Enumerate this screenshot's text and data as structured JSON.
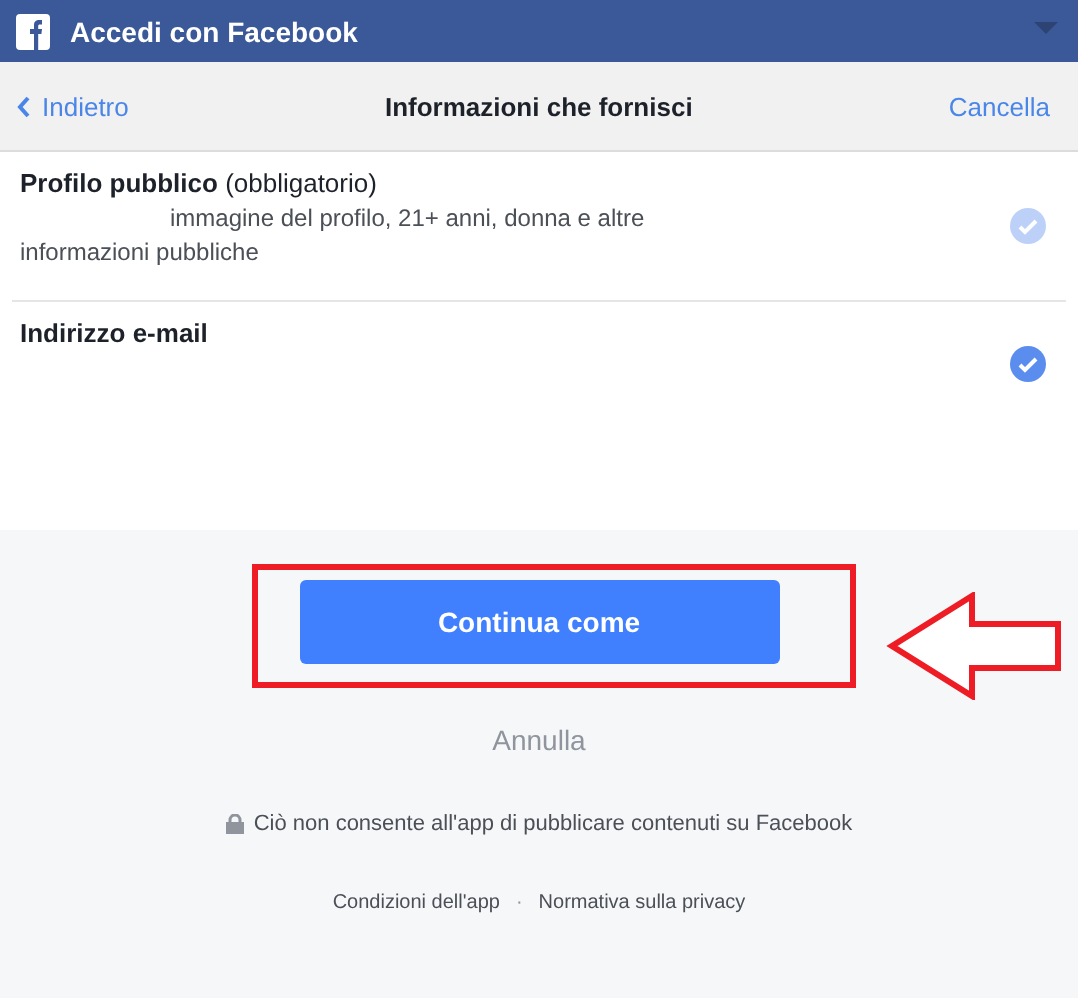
{
  "window": {
    "title": "Accedi con Facebook"
  },
  "nav": {
    "back": "Indietro",
    "title": "Informazioni che fornisci",
    "cancel": "Cancella"
  },
  "permissions": [
    {
      "title": "Profilo pubblico",
      "note": "(obbligatorio)",
      "description": "immagine del profilo, 21+ anni, donna e altre informazioni pubbliche",
      "checked": true,
      "disabled": true
    },
    {
      "title": "Indirizzo e-mail",
      "checked": true,
      "disabled": false
    }
  ],
  "continue_button": "Continua come",
  "cancel_link": "Annulla",
  "notice": "Ciò non consente all'app di pubblicare contenuti su Facebook",
  "footer_links": [
    "Condizioni dell'app",
    "Normativa sulla privacy"
  ],
  "footer_separator": "·",
  "annotation": {
    "highlight": true,
    "arrow": true
  }
}
